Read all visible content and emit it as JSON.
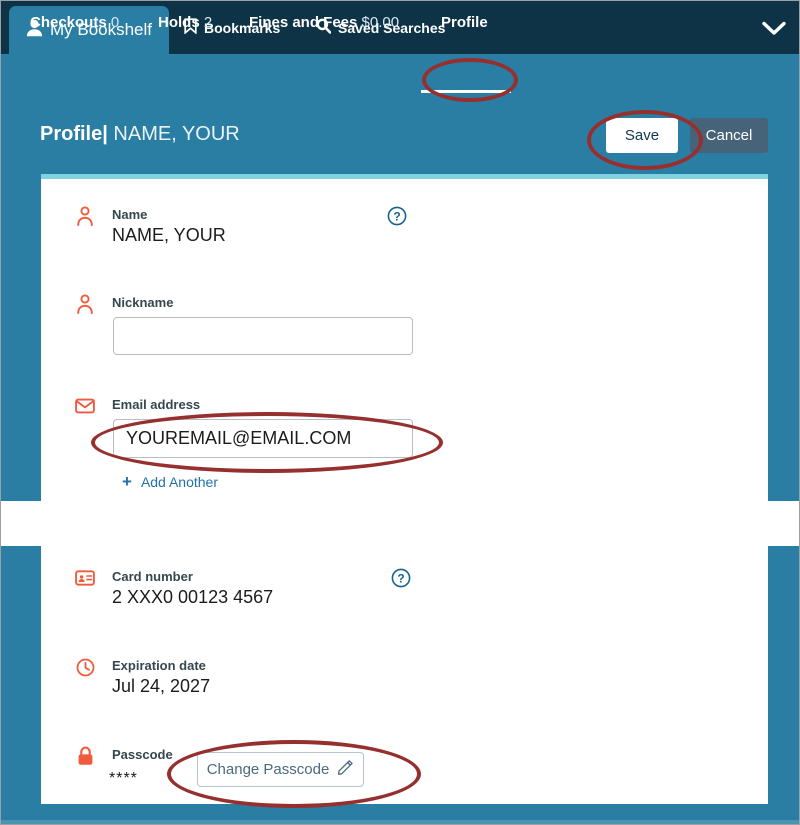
{
  "topnav": {
    "primary_tab": {
      "label": "My Bookshelf",
      "icon": "person-icon"
    },
    "links": [
      {
        "label": "Bookmarks",
        "icon": "bookmark-icon"
      },
      {
        "label": "Saved Searches",
        "icon": "search-icon"
      }
    ],
    "expand_icon": "chevron-down-icon"
  },
  "subnav": {
    "tabs": [
      {
        "label": "Checkouts",
        "value": "0"
      },
      {
        "label": "Holds",
        "value": "2"
      },
      {
        "label": "Fines and Fees",
        "value": "$0.00"
      },
      {
        "label": "Profile",
        "value": ""
      }
    ],
    "active": "Profile"
  },
  "header": {
    "title": "Profile",
    "separator": "|",
    "user_name": "NAME, YOUR",
    "save_label": "Save",
    "cancel_label": "Cancel"
  },
  "profile": {
    "name": {
      "label": "Name",
      "value": "NAME, YOUR",
      "help": "?"
    },
    "nickname": {
      "label": "Nickname",
      "value": "",
      "placeholder": ""
    },
    "email": {
      "label": "Email address",
      "value": "YOUREMAIL@EMAIL.COM",
      "add_another": "Add Another",
      "add_icon": "plus-icon"
    }
  },
  "card_info": {
    "card_number": {
      "label": "Card number",
      "value": "2 XXX0 00123 4567",
      "help": "?"
    },
    "expiration": {
      "label": "Expiration date",
      "value": "Jul 24, 2027"
    },
    "passcode": {
      "label": "Passcode",
      "value": "****",
      "button_label": "Change Passcode",
      "button_icon": "pencil-edit-icon"
    }
  },
  "colors": {
    "dark_navy": "#0e3346",
    "teal": "#2a7da3",
    "cyan_rule": "#7fd2e2",
    "orange_icon": "#ef5b3c",
    "link_blue": "#2272a8",
    "annotation_red": "#96302f",
    "cancel_slate": "#476379"
  }
}
